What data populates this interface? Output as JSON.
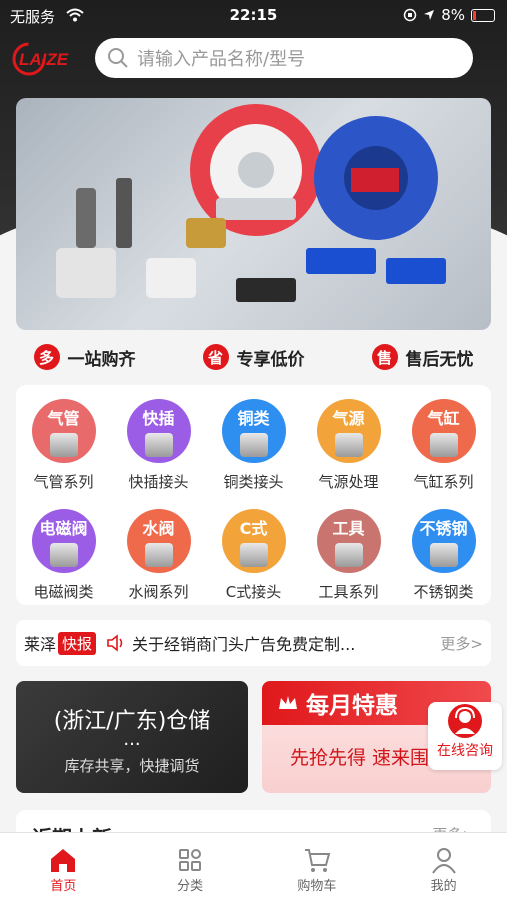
{
  "status_bar": {
    "carrier": "无服务",
    "time": "22:15",
    "battery": "8%"
  },
  "header": {
    "logo_text": "LAIZE",
    "search_placeholder": "请输入产品名称/型号"
  },
  "features": [
    {
      "badge": "多",
      "label": "一站购齐"
    },
    {
      "badge": "省",
      "label": "专享低价"
    },
    {
      "badge": "售",
      "label": "售后无忧"
    }
  ],
  "categories": [
    {
      "tag": "气管",
      "label": "气管系列",
      "color": "#e96a6a"
    },
    {
      "tag": "快插",
      "label": "快插接头",
      "color": "#9b5de5"
    },
    {
      "tag": "铜类",
      "label": "铜类接头",
      "color": "#2f8ff0"
    },
    {
      "tag": "气源",
      "label": "气源处理",
      "color": "#f2a33a"
    },
    {
      "tag": "气缸",
      "label": "气缸系列",
      "color": "#ee6a4b"
    },
    {
      "tag": "电磁阀",
      "label": "电磁阀类",
      "color": "#9b5de5"
    },
    {
      "tag": "水阀",
      "label": "水阀系列",
      "color": "#ee6a4b"
    },
    {
      "tag": "C式",
      "label": "C式接头",
      "color": "#f2a33a"
    },
    {
      "tag": "工具",
      "label": "工具系列",
      "color": "#c9746e"
    },
    {
      "tag": "不锈钢",
      "label": "不锈钢类",
      "color": "#2f8ff0"
    }
  ],
  "news": {
    "brand": "莱泽",
    "badge": "快报",
    "message": "关于经销商门头广告免费定制...",
    "more": "更多>"
  },
  "promo_left": {
    "title": "(浙江/广东)仓储",
    "ellipsis": "...",
    "subtitle": "库存共享，快捷调货"
  },
  "promo_right": {
    "title": "每月特惠",
    "subtitle": "先抢先得 速来围观"
  },
  "consult": {
    "label": "在线咨询"
  },
  "section": {
    "title": "近期上新",
    "more": "更多>"
  },
  "tabs": [
    {
      "label": "首页",
      "icon": "home-icon"
    },
    {
      "label": "分类",
      "icon": "grid-icon"
    },
    {
      "label": "购物车",
      "icon": "cart-icon"
    },
    {
      "label": "我的",
      "icon": "user-icon"
    }
  ],
  "colors": {
    "brand": "#e0181b"
  }
}
